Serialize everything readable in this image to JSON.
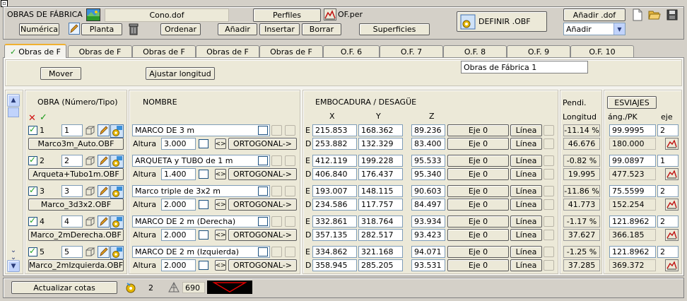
{
  "header": {
    "title": "OBRAS DE FÁBRICA",
    "file": "Cono.dof",
    "perfiles": "Perfiles",
    "perfiles_file": "OF.per",
    "definir": "DEFINIR .OBF",
    "anadir_dof": "Añadir .dof",
    "mode_value": "Añadir"
  },
  "toolbar": {
    "numerica": "Numérica",
    "planta": "Planta",
    "ordenar": "Ordenar",
    "anadir": "Añadir",
    "insertar": "Insertar",
    "borrar": "Borrar",
    "superficies": "Superficies"
  },
  "tabs": [
    "Obras de F",
    "Obras de F",
    "Obras de F",
    "Obras de F",
    "Obras de F",
    "O.F. 6",
    "O.F. 7",
    "O.F. 8",
    "O.F. 9",
    "O.F. 10"
  ],
  "panel": {
    "mover": "Mover",
    "ajustar": "Ajustar longitud",
    "name_value": "Obras de Fábrica 1"
  },
  "cols": {
    "obra": "OBRA (Número/Tipo)",
    "nombre": "NOMBRE",
    "emb": "EMBOCADURA / DESAGÜE",
    "x": "X",
    "y": "Y",
    "z": "Z",
    "pendi": "Pendi.",
    "longitud": "Longitud",
    "esviajes": "ESVIAJES",
    "angpk": "áng./PK",
    "eje": "eje"
  },
  "rows": [
    {
      "num": "1",
      "idx": "1",
      "file": "Marco3m_Auto.OBF",
      "name": "MARCO DE 3 m",
      "altura_label": "Altura",
      "altura": "3.000",
      "orto": "ORTOGONAL->",
      "e_x": "215.853",
      "e_y": "168.362",
      "e_z": "89.236",
      "d_x": "253.882",
      "d_y": "132.329",
      "d_z": "83.400",
      "eje_label": "Eje 0",
      "linea": "Línea",
      "pend": "-11.14 %",
      "long": "46.676",
      "ang": "99.9995",
      "eje": "2",
      "pk": "180.000"
    },
    {
      "num": "2",
      "idx": "2",
      "file": "Arqueta+Tubo1m.OBF",
      "name": "ARQUETA  y TUBO de 1 m",
      "altura_label": "Altura",
      "altura": "1.400",
      "orto": "ORTOGONAL->",
      "e_x": "412.119",
      "e_y": "199.228",
      "e_z": "95.533",
      "d_x": "406.840",
      "d_y": "176.437",
      "d_z": "95.340",
      "eje_label": "Eje 0",
      "linea": "Línea",
      "pend": "-0.82 %",
      "long": "19.995",
      "ang": "99.0897",
      "eje": "1",
      "pk": "477.523"
    },
    {
      "num": "3",
      "idx": "3",
      "file": "Marco_3d3x2.OBF",
      "name": "Marco triple de 3x2 m",
      "altura_label": "Altura",
      "altura": "2.000",
      "orto": "ORTOGONAL->",
      "e_x": "193.007",
      "e_y": "148.115",
      "e_z": "90.603",
      "d_x": "234.586",
      "d_y": "117.757",
      "d_z": "84.497",
      "eje_label": "Eje 0",
      "linea": "Línea",
      "pend": "-11.86 %",
      "long": "41.773",
      "ang": "75.5599",
      "eje": "2",
      "pk": "152.254"
    },
    {
      "num": "4",
      "idx": "4",
      "file": "Marco_2mDerecha.OBF",
      "name": "MARCO DE 2 m (Derecha)",
      "altura_label": "Altura",
      "altura": "2.000",
      "orto": "ORTOGONAL->",
      "e_x": "332.861",
      "e_y": "318.764",
      "e_z": "93.934",
      "d_x": "357.135",
      "d_y": "282.517",
      "d_z": "93.423",
      "eje_label": "Eje 0",
      "linea": "Línea",
      "pend": "-1.17 %",
      "long": "37.627",
      "ang": "121.8962",
      "eje": "2",
      "pk": "366.185"
    },
    {
      "num": "5",
      "idx": "5",
      "file": "Marco_2mIzquierda.OBF",
      "name": "MARCO DE 2 m (Izquierda)",
      "altura_label": "Altura",
      "altura": "2.000",
      "orto": "ORTOGONAL->",
      "e_x": "334.862",
      "e_y": "321.168",
      "e_z": "94.071",
      "d_x": "358.945",
      "d_y": "285.205",
      "d_z": "93.531",
      "eje_label": "Eje 0",
      "linea": "Línea",
      "pend": "-1.25 %",
      "long": "37.285",
      "ang": "121.8962",
      "eje": "2",
      "pk": "369.372"
    }
  ],
  "footer": {
    "actualizar": "Actualizar cotas",
    "count": "2",
    "tri_count": "690"
  },
  "colors": {
    "accent": "#f0b030",
    "bg": "#d4d0c8",
    "link_blue": "#1c5180"
  }
}
